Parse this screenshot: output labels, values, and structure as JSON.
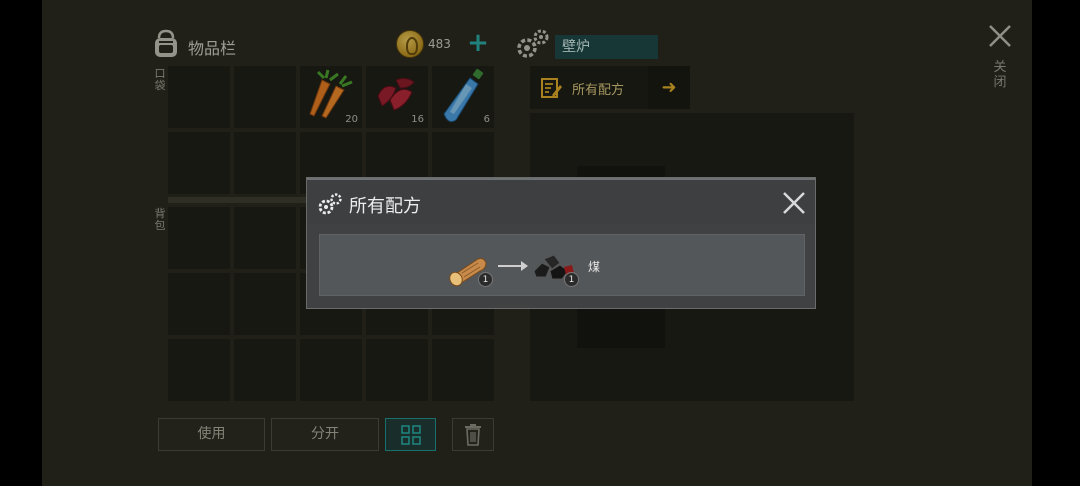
{
  "inventory": {
    "title": "物品栏",
    "coins": "483",
    "pocket_label": "口袋",
    "backpack_label": "背包",
    "pocket_slots": [
      {
        "item": "",
        "qty": ""
      },
      {
        "item": "",
        "qty": ""
      },
      {
        "item": "carrot",
        "qty": "20"
      },
      {
        "item": "raw-meat",
        "qty": "16"
      },
      {
        "item": "water-bottle",
        "qty": "6"
      },
      {
        "item": "",
        "qty": ""
      },
      {
        "item": "",
        "qty": ""
      },
      {
        "item": "",
        "qty": ""
      },
      {
        "item": "",
        "qty": ""
      },
      {
        "item": "",
        "qty": ""
      }
    ],
    "buttons": {
      "use": "使用",
      "split": "分开"
    }
  },
  "crafting": {
    "station_name": "壁炉",
    "recipes_tab": "所有配方"
  },
  "close": {
    "label": "关闭"
  },
  "modal": {
    "title": "所有配方",
    "recipe": {
      "ingredient": "wood-log",
      "ingredient_qty": "1",
      "product": "coal",
      "product_qty": "1",
      "product_name": "煤"
    }
  },
  "colors": {
    "accent_teal": "#2aa6a0",
    "gold": "#d9a728",
    "panel": "#29291f",
    "slot": "#1f1f18"
  }
}
